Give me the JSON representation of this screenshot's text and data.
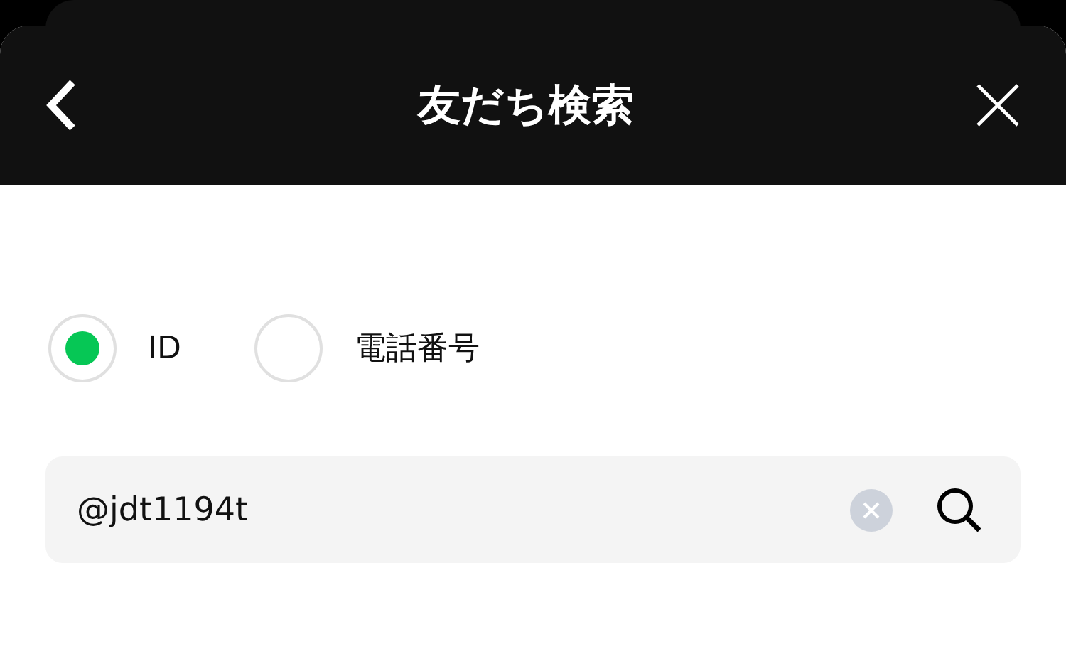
{
  "header": {
    "title": "友だち検索"
  },
  "search_type": [
    {
      "label": "ID",
      "selected": true
    },
    {
      "label": "電話番号",
      "selected": false
    }
  ],
  "search": {
    "value": "@jdt1194t"
  }
}
